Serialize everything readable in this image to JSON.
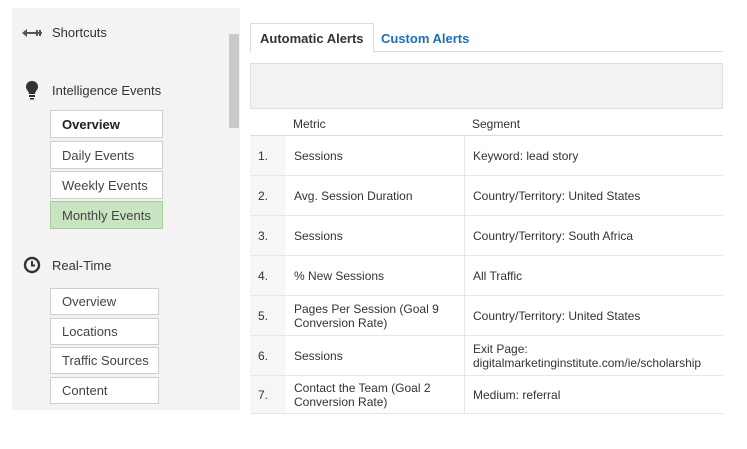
{
  "sidebar": {
    "shortcuts": {
      "label": "Shortcuts",
      "icon": "shortcuts-arrow-icon"
    },
    "intelligence": {
      "label": "Intelligence Events",
      "icon": "lightbulb-icon",
      "items": [
        {
          "label": "Overview"
        },
        {
          "label": "Daily Events"
        },
        {
          "label": "Weekly Events"
        },
        {
          "label": "Monthly Events"
        }
      ]
    },
    "realtime": {
      "label": "Real-Time",
      "icon": "clock-icon",
      "items": [
        {
          "label": "Overview"
        },
        {
          "label": "Locations"
        },
        {
          "label": "Traffic Sources"
        },
        {
          "label": "Content"
        }
      ]
    }
  },
  "tabs": [
    {
      "label": "Automatic Alerts",
      "active": true
    },
    {
      "label": "Custom Alerts",
      "active": false
    }
  ],
  "colors": {
    "selected_bg": "#c8e4c0",
    "tab_link": "#1d6fb8"
  },
  "table": {
    "headers": {
      "metric": "Metric",
      "segment": "Segment"
    },
    "rows": [
      {
        "num": "1.",
        "metric": "Sessions",
        "segment": "Keyword: lead story"
      },
      {
        "num": "2.",
        "metric": "Avg. Session Duration",
        "segment": "Country/Territory: United States"
      },
      {
        "num": "3.",
        "metric": "Sessions",
        "segment": "Country/Territory: South Africa"
      },
      {
        "num": "4.",
        "metric": "% New Sessions",
        "segment": "All Traffic"
      },
      {
        "num": "5.",
        "metric": "Pages Per Session (Goal 9 Conversion Rate)",
        "segment": "Country/Territory: United States"
      },
      {
        "num": "6.",
        "metric": "Sessions",
        "segment": "Exit Page: digitalmarketinginstitute.com/ie/scholarship"
      },
      {
        "num": "7.",
        "metric": "Contact the Team (Goal 2 Conversion Rate)",
        "segment": "Medium: referral"
      }
    ]
  }
}
